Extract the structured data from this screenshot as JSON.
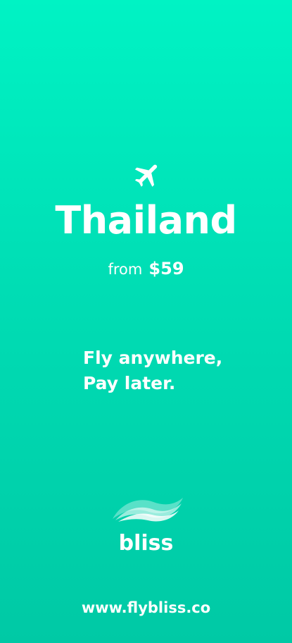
{
  "destination": "Thailand",
  "price": {
    "prefix": "from",
    "amount": "$59"
  },
  "tagline": {
    "line1": "Fly anywhere,",
    "line2": "Pay later."
  },
  "brand": {
    "name": "bliss",
    "logo_icon": "wave-logo-icon"
  },
  "website": "www.flybliss.co",
  "icons": {
    "hero": "airplane-icon"
  },
  "colors": {
    "background_top": "#00F3C4",
    "background_bottom": "#00C9A5",
    "text": "#FFFFFF"
  }
}
